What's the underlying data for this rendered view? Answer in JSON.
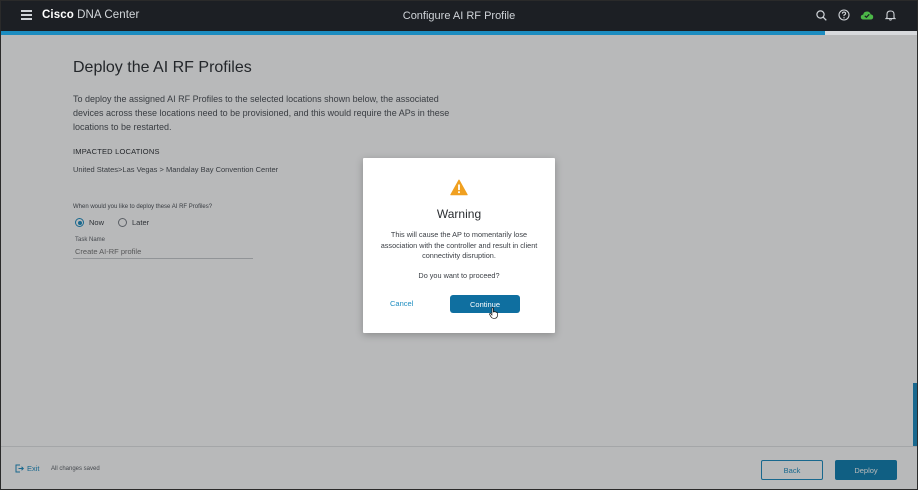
{
  "header": {
    "brand_bold": "Cisco",
    "brand_light": "DNA Center",
    "title": "Configure AI RF Profile",
    "icons": [
      "search-icon",
      "help-icon",
      "cloud-status-icon",
      "bell-icon"
    ]
  },
  "progress": {
    "fraction": 0.9
  },
  "main": {
    "title": "Deploy the AI RF Profiles",
    "description": "To deploy the assigned AI RF Profiles to the selected locations shown below, the associated devices across these locations need to be provisioned, and this would require the APs in these locations to be restarted.",
    "impacted_label": "IMPACTED LOCATIONS",
    "location": "United States>Las Vegas > Mandalay Bay Convention Center",
    "deploy_question": "When would you like to deploy these AI RF Profiles?",
    "options": [
      {
        "label": "Now",
        "selected": true
      },
      {
        "label": "Later",
        "selected": false
      }
    ],
    "task_name_label": "Task Name",
    "task_name_placeholder": "Create AI-RF profile"
  },
  "footer": {
    "exit_label": "Exit",
    "saved_text": "All changes saved",
    "back_label": "Back",
    "deploy_label": "Deploy"
  },
  "modal": {
    "title": "Warning",
    "body": "This will cause the AP to momentarily lose association with the controller and result in client connectivity disruption.",
    "question": "Do you want to proceed?",
    "cancel_label": "Cancel",
    "continue_label": "Continue"
  },
  "colors": {
    "accent": "#1c8cc0",
    "header_bg": "#1c1f24",
    "warning": "#f0a020",
    "status_green": "#4cb848"
  }
}
